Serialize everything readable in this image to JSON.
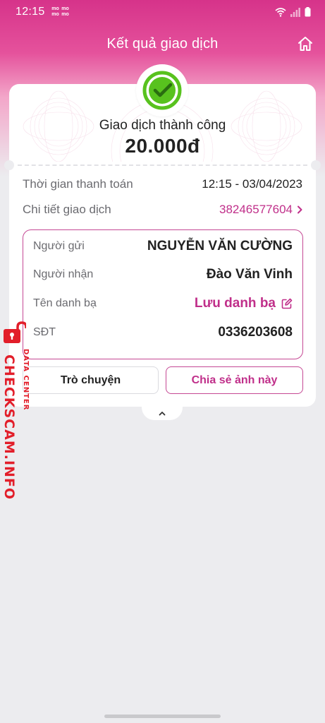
{
  "status_bar": {
    "time": "12:15",
    "app_badge": [
      "mo",
      "mo",
      "mo",
      "mo"
    ],
    "icons": [
      "wifi-icon",
      "signal-icon",
      "battery-icon"
    ]
  },
  "nav": {
    "title": "Kết quả giao dịch",
    "home_icon": "home-icon"
  },
  "summary": {
    "status": "Giao dịch thành công",
    "amount": "20.000đ",
    "status_icon": "check-circle-icon"
  },
  "info": {
    "payment_time_label": "Thời gian thanh toán",
    "payment_time_value": "12:15 - 03/04/2023",
    "detail_label": "Chi tiết giao dịch",
    "detail_value": "38246577604"
  },
  "details": {
    "sender_label": "Người gửi",
    "sender_value": "NGUYỄN VĂN CƯỜNG",
    "receiver_label": "Người nhận",
    "receiver_value": "Đào Văn Vinh",
    "contact_label": "Tên danh bạ",
    "contact_action": "Lưu danh bạ",
    "phone_label": "SĐT",
    "phone_value": "0336203608"
  },
  "actions": {
    "chat_label": "Trò chuyện",
    "share_label": "Chia sẻ ảnh này"
  },
  "watermark": {
    "main": "CHECKSCAM.INFO",
    "sub": "DATA CENTER"
  },
  "colors": {
    "brand": "#c02f8a",
    "success": "#58c21e",
    "watermark": "#e21e2a"
  }
}
